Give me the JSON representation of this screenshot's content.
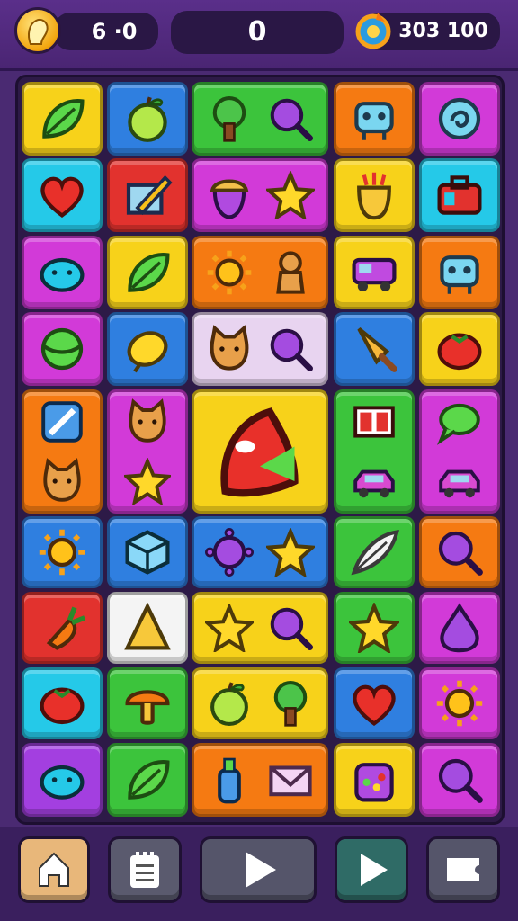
{
  "hud": {
    "lives": "6 ·0",
    "score": "0",
    "gems": "303 100"
  },
  "colors": {
    "yellow": "#f7d21a",
    "blue": "#2f7fe0",
    "green": "#3cc43c",
    "orange": "#f57a12",
    "magenta": "#d23ad8",
    "cyan": "#25c9e8",
    "red": "#e2322e",
    "purple": "#a33fe0",
    "lavender": "#e8d4f0",
    "white": "#f4f4f4"
  },
  "board": {
    "tiles": [
      {
        "color": "yellow",
        "icon": "leaf-icon"
      },
      {
        "color": "blue",
        "icon": "apple-icon"
      },
      {
        "color": "green",
        "icons": [
          "tree-icon",
          "magnifier-icon"
        ]
      },
      {
        "color": "orange",
        "icon": "robot-icon"
      },
      {
        "color": "magenta",
        "icon": "swirl-icon"
      },
      {
        "color": "cyan",
        "icon": "heart-icon"
      },
      {
        "color": "red",
        "icon": "pencil-icon"
      },
      {
        "color": "magenta",
        "icons": [
          "acorn-icon",
          "star-icon"
        ]
      },
      {
        "color": "yellow",
        "icon": "fruit-icon"
      },
      {
        "color": "cyan",
        "icon": "suitcase-icon"
      },
      {
        "color": "magenta",
        "icon": "blob-icon"
      },
      {
        "color": "yellow",
        "icon": "leaf-icon"
      },
      {
        "color": "orange",
        "icons": [
          "sun-icon",
          "gingerbread-icon"
        ]
      },
      {
        "color": "yellow",
        "icon": "truck-icon"
      },
      {
        "color": "orange",
        "icon": "robot-icon"
      },
      {
        "color": "magenta",
        "icon": "ball-icon"
      },
      {
        "color": "blue",
        "icon": "lemon-icon"
      },
      {
        "color": "lavender",
        "icons": [
          "cat-icon",
          "magnifier-icon"
        ]
      },
      {
        "color": "blue",
        "icon": "popsicle-icon"
      },
      {
        "color": "yellow",
        "icon": "tomato-icon"
      },
      {
        "color": "orange",
        "icons": [
          "pen-icon",
          "cat-icon"
        ]
      },
      {
        "color": "magenta",
        "icons": [
          "cat-icon",
          "star-icon"
        ]
      },
      {
        "color": "yellow",
        "icon": "flag-icon"
      },
      {
        "color": "green",
        "icons": [
          "window-icon",
          "car-icon"
        ]
      },
      {
        "color": "magenta",
        "icons": [
          "chat-icon",
          "car-icon"
        ]
      },
      {
        "color": "blue",
        "icon": "sun-icon"
      },
      {
        "color": "blue",
        "icon": "cube-icon"
      },
      {
        "color": "blue",
        "icons": [
          "virus-icon",
          "star-icon"
        ]
      },
      {
        "color": "green",
        "icon": "feather-icon"
      },
      {
        "color": "orange",
        "icon": "magnifier-icon"
      },
      {
        "color": "red",
        "icon": "carrot-icon"
      },
      {
        "color": "white",
        "icon": "cone-icon"
      },
      {
        "color": "yellow",
        "icons": [
          "star-icon",
          "magnifier-icon"
        ]
      },
      {
        "color": "green",
        "icon": "star-icon"
      },
      {
        "color": "magenta",
        "icon": "drop-icon"
      },
      {
        "color": "cyan",
        "icon": "tomato-icon"
      },
      {
        "color": "green",
        "icon": "mushroom-icon"
      },
      {
        "color": "yellow",
        "icons": [
          "apple-icon",
          "tree-icon"
        ]
      },
      {
        "color": "blue",
        "icon": "heart-icon"
      },
      {
        "color": "magenta",
        "icon": "sun-icon"
      },
      {
        "color": "purple",
        "icon": "blob-icon"
      },
      {
        "color": "green",
        "icon": "leaf-icon"
      },
      {
        "color": "orange",
        "icons": [
          "bottle-icon",
          "envelope-icon"
        ]
      },
      {
        "color": "yellow",
        "icon": "candy-jar-icon"
      },
      {
        "color": "magenta",
        "icon": "magnifier-icon"
      }
    ]
  },
  "toolbar": {
    "buttons": [
      {
        "name": "home-button",
        "icon": "home-icon"
      },
      {
        "name": "menu-button",
        "icon": "notepad-icon"
      },
      {
        "name": "play-button",
        "icon": "play-icon"
      },
      {
        "name": "next-button",
        "icon": "play-icon"
      },
      {
        "name": "ticket-button",
        "icon": "ticket-icon"
      }
    ]
  }
}
